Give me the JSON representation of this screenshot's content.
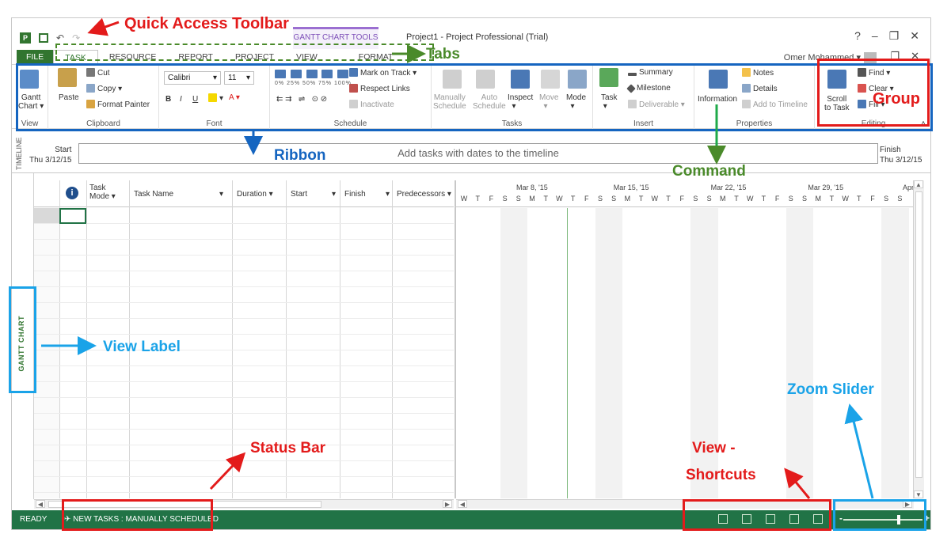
{
  "app": {
    "qat_icons": [
      "project-app-icon",
      "save-icon",
      "undo-icon",
      "redo-icon"
    ],
    "context_tab": "GANTT CHART TOOLS",
    "doc_title": "Project1 - Project Professional (Trial)",
    "user": "Omer Mohammed",
    "help": "?"
  },
  "tabs": [
    "FILE",
    "TASK",
    "RESOURCE",
    "REPORT",
    "PROJECT",
    "VIEW",
    "FORMAT"
  ],
  "ribbon": {
    "view": {
      "gantt": "Gantt",
      "chart": "Chart",
      "label": "View"
    },
    "clipboard": {
      "paste": "Paste",
      "cut": "Cut",
      "copy": "Copy",
      "format_painter": "Format Painter",
      "label": "Clipboard"
    },
    "font": {
      "family": "Calibri",
      "size": "11",
      "bold": "B",
      "italic": "I",
      "underline": "U",
      "label": "Font"
    },
    "schedule": {
      "pct": [
        "0%",
        "25%",
        "50%",
        "75%",
        "100%"
      ],
      "mark_on_track": "Mark on Track",
      "respect_links": "Respect Links",
      "inactivate": "Inactivate",
      "label": "Schedule"
    },
    "tasks": {
      "manually": "Manually",
      "schedule1": "Schedule",
      "auto": "Auto",
      "schedule2": "Schedule",
      "inspect": "Inspect",
      "move": "Move",
      "mode": "Mode",
      "label": "Tasks"
    },
    "insert": {
      "task": "Task",
      "summary": "Summary",
      "milestone": "Milestone",
      "deliverable": "Deliverable",
      "label": "Insert"
    },
    "properties": {
      "information": "Information",
      "notes": "Notes",
      "details": "Details",
      "add_to_timeline": "Add to Timeline",
      "label": "Properties"
    },
    "editing": {
      "scroll": "Scroll",
      "to_task": "to Task",
      "find": "Find",
      "clear": "Clear",
      "fill": "Fill",
      "label": "Editing"
    }
  },
  "timeline": {
    "side_label": "TIMELINE",
    "start_label": "Start",
    "start_date": "Thu 3/12/15",
    "placeholder": "Add tasks with dates to the timeline",
    "finish_label": "Finish",
    "finish_date": "Thu 3/12/15"
  },
  "grid": {
    "columns": [
      "Task Mode",
      "Task Name",
      "Duration",
      "Start",
      "Finish",
      "Predecessors"
    ],
    "task_mode_line1": "Task",
    "task_mode_line2": "Mode"
  },
  "chart": {
    "weeks": [
      "Mar 8, '15",
      "Mar 15, '15",
      "Mar 22, '15",
      "Mar 29, '15",
      "Apr"
    ],
    "days": [
      "W",
      "T",
      "F",
      "S",
      "S",
      "M",
      "T",
      "W",
      "T",
      "F",
      "S",
      "S",
      "M",
      "T",
      "W",
      "T",
      "F",
      "S",
      "S",
      "M",
      "T",
      "W",
      "T",
      "F",
      "S",
      "S",
      "M",
      "T",
      "W",
      "T",
      "F",
      "S",
      "S"
    ]
  },
  "view_label": "GANTT CHART",
  "status": {
    "ready": "READY",
    "new_tasks": "NEW TASKS : MANUALLY SCHEDULED",
    "view_shortcuts": [
      "gantt-view-icon",
      "task-usage-icon",
      "team-planner-icon",
      "resource-sheet-icon",
      "report-icon"
    ]
  },
  "annotations": {
    "qat": "Quick Access Toolbar",
    "tabs": "Tabs",
    "ribbon": "Ribbon",
    "command": "Command",
    "group": "Group",
    "view_label": "View Label",
    "status_bar": "Status Bar",
    "view_shortcuts_1": "View -",
    "view_shortcuts_2": "Shortcuts",
    "zoom_slider": "Zoom Slider"
  },
  "colors": {
    "project_green": "#217346",
    "annotation_red": "#e31b1b",
    "annotation_green": "#4a8a2a",
    "annotation_blue": "#1565c0",
    "annotation_cyan": "#1aa3e8"
  }
}
